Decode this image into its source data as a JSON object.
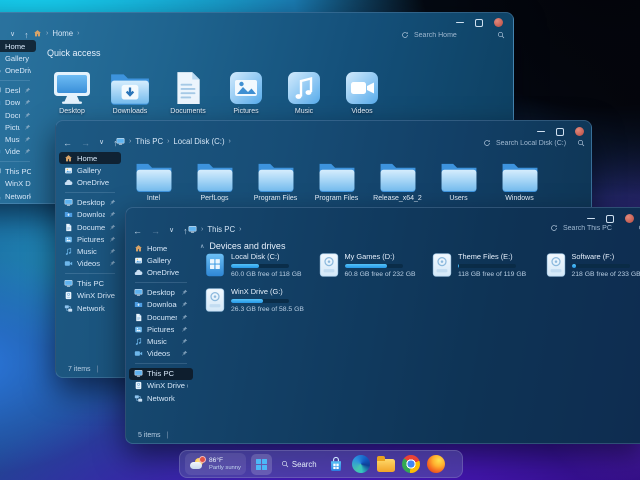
{
  "colors": {
    "accent": "#38b2f4",
    "close_button": "#b74a40",
    "folder_blue": "#7fc1f1"
  },
  "shared_sidebar": {
    "top": [
      {
        "label": "Home",
        "icon": "home"
      },
      {
        "label": "Gallery",
        "icon": "gallery"
      },
      {
        "label": "OneDrive",
        "icon": "cloud"
      }
    ],
    "pinned": [
      {
        "label": "Desktop",
        "icon": "monitor"
      },
      {
        "label": "Downloads",
        "icon": "download"
      },
      {
        "label": "Documents",
        "icon": "doc"
      },
      {
        "label": "Pictures",
        "icon": "image"
      },
      {
        "label": "Music",
        "icon": "music"
      },
      {
        "label": "Videos",
        "icon": "video"
      }
    ],
    "bottom": [
      {
        "label": "This PC",
        "icon": "monitor"
      },
      {
        "label": "WinX Drive (G:)",
        "icon": "drive"
      },
      {
        "label": "Network",
        "icon": "network"
      }
    ]
  },
  "home_window": {
    "breadcrumb": {
      "segments": [
        "Home"
      ]
    },
    "search_placeholder": "Search Home",
    "section_title": "Quick access",
    "selected_sidebar": "Home",
    "items": [
      {
        "label": "Desktop",
        "icon": "monitor-large"
      },
      {
        "label": "Downloads",
        "icon": "folder-download"
      },
      {
        "label": "Documents",
        "icon": "document-large"
      },
      {
        "label": "Pictures",
        "icon": "pictures-tile"
      },
      {
        "label": "Music",
        "icon": "music-tile"
      },
      {
        "label": "Videos",
        "icon": "video-tile"
      }
    ]
  },
  "disk_window": {
    "breadcrumb": {
      "segments": [
        "This PC",
        "Local Disk (C:)"
      ]
    },
    "search_placeholder": "Search Local Disk (C:)",
    "status_count": "7 items",
    "selected_sidebar": "Home",
    "folders": [
      "Intel",
      "PerfLogs",
      "Program Files",
      "Program Files",
      "Release_x64_2",
      "Users",
      "Windows"
    ]
  },
  "pc_window": {
    "breadcrumb": {
      "segments": [
        "This PC"
      ]
    },
    "search_placeholder": "Search This PC",
    "section_title": "Devices and drives",
    "status_count": "5 items",
    "selected_sidebar": "This PC",
    "drives": [
      {
        "name": "Local Disk (C:)",
        "detail": "60.0 GB free of 118 GB",
        "used_pct": 49,
        "icon": "windows-drive",
        "col": 0,
        "row": 0
      },
      {
        "name": "WinX Drive (G:)",
        "detail": "26.3 GB free of 58.5 GB",
        "used_pct": 55,
        "icon": "drive-card",
        "col": 0,
        "row": 1
      },
      {
        "name": "My Games (D:)",
        "detail": "60.8 GB free of 232 GB",
        "used_pct": 74,
        "icon": "drive-card",
        "col": 1,
        "row": 0
      },
      {
        "name": "Theme Files (E:)",
        "detail": "118 GB free of 119 GB",
        "used_pct": 2,
        "icon": "drive-card",
        "col": 2,
        "row": 0
      },
      {
        "name": "Software (F:)",
        "detail": "218 GB free of 233 GB",
        "used_pct": 7,
        "icon": "drive-card",
        "col": 3,
        "row": 0
      }
    ]
  },
  "taskbar": {
    "weather": {
      "temp": "86°F",
      "condition": "Partly sunny"
    },
    "search_label": "Search",
    "apps": [
      "store",
      "edge",
      "file-explorer",
      "chrome",
      "firefox"
    ]
  }
}
